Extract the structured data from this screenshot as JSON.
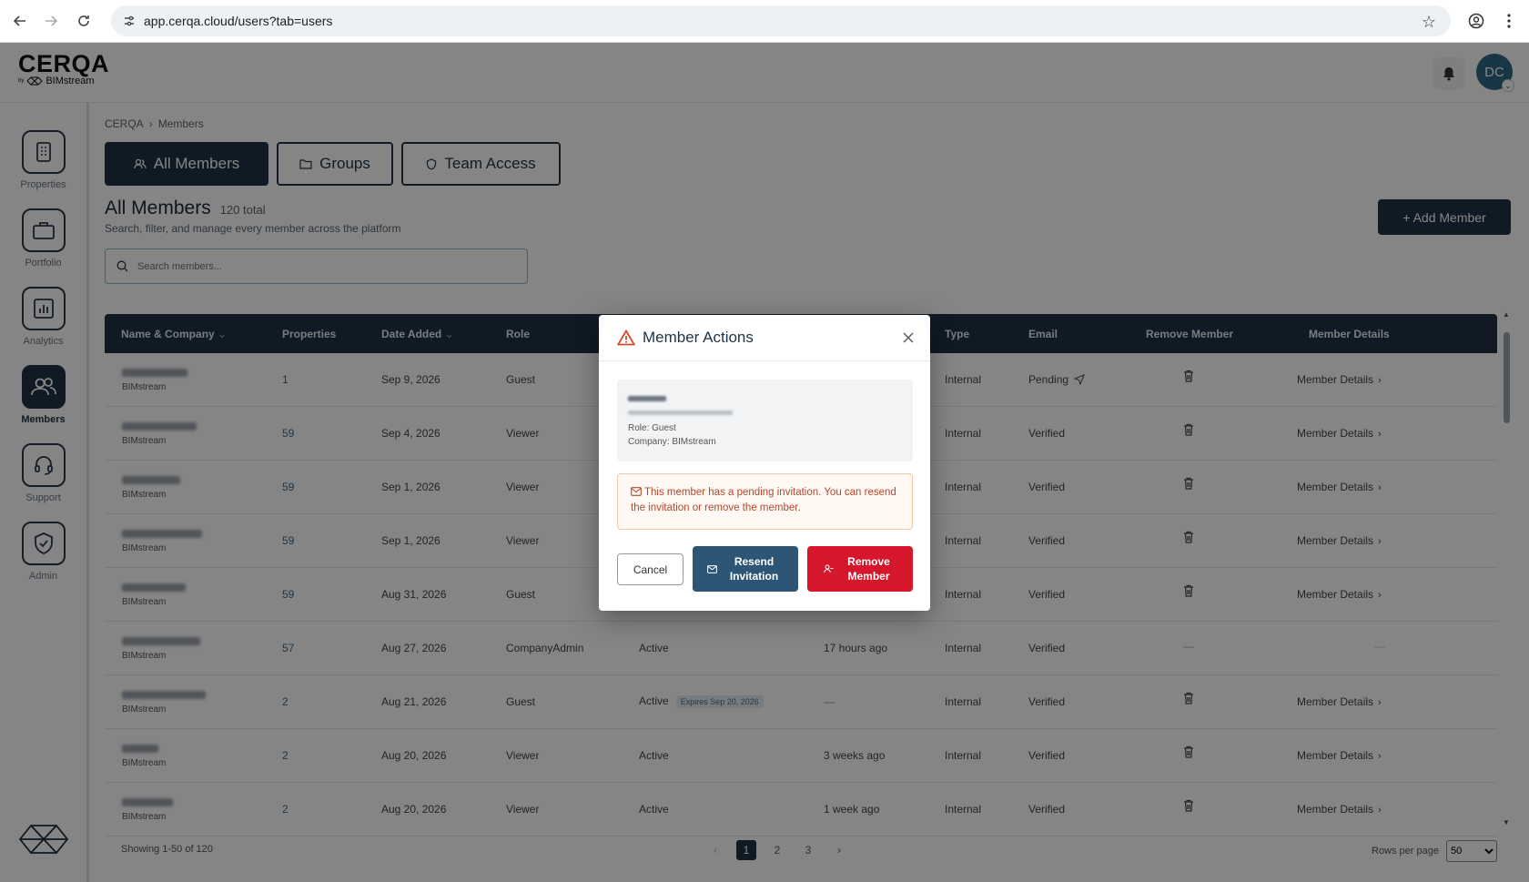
{
  "browser": {
    "url": "app.cerqa.cloud/users?tab=users"
  },
  "brand": {
    "name": "CERQA",
    "by": "by",
    "sub": "BIMstream"
  },
  "header": {
    "avatar_initials": "DC"
  },
  "sidebar": {
    "items": [
      {
        "label": "Properties",
        "icon": "building-icon"
      },
      {
        "label": "Portfolio",
        "icon": "briefcase-icon"
      },
      {
        "label": "Analytics",
        "icon": "chart-icon"
      },
      {
        "label": "Members",
        "icon": "users-icon",
        "active": true
      },
      {
        "label": "Support",
        "icon": "headset-icon"
      },
      {
        "label": "Admin",
        "icon": "shield-check-icon"
      }
    ]
  },
  "breadcrumb": [
    "CERQA",
    "›",
    "Members"
  ],
  "tabs": [
    {
      "label": "All Members",
      "active": true
    },
    {
      "label": "Groups"
    },
    {
      "label": "Team Access"
    }
  ],
  "page": {
    "title": "All Members",
    "count": "120 total",
    "subtitle": "Search, filter, and manage every member across the platform",
    "add_button": "+ Add Member",
    "search_placeholder": "Search members..."
  },
  "table": {
    "headers": [
      "Name & Company",
      "Properties",
      "Date Added",
      "Role",
      "Type",
      "Email",
      "Remove Member",
      "Member Details"
    ],
    "rows": [
      {
        "company": "BIMstream",
        "properties": "1",
        "date": "Sep 9, 2026",
        "role": "Guest",
        "status": "",
        "last": "",
        "type": "Internal",
        "email": "Pending",
        "details": "Member Details"
      },
      {
        "company": "BIMstream",
        "properties": "59",
        "date": "Sep 4, 2026",
        "role": "Viewer",
        "status": "",
        "last": "",
        "type": "Internal",
        "email": "Verified",
        "details": "Member Details"
      },
      {
        "company": "BIMstream",
        "properties": "59",
        "date": "Sep 1, 2026",
        "role": "Viewer",
        "status": "",
        "last": "",
        "type": "Internal",
        "email": "Verified",
        "details": "Member Details"
      },
      {
        "company": "BIMstream",
        "properties": "59",
        "date": "Sep 1, 2026",
        "role": "Viewer",
        "status": "",
        "last": "",
        "type": "Internal",
        "email": "Verified",
        "details": "Member Details"
      },
      {
        "company": "BIMstream",
        "properties": "59",
        "date": "Aug 31, 2026",
        "role": "Guest",
        "status": "",
        "last": "",
        "type": "Internal",
        "email": "Verified",
        "details": "Member Details"
      },
      {
        "company": "BIMstream",
        "properties": "57",
        "date": "Aug 27, 2026",
        "role": "CompanyAdmin",
        "status": "Active",
        "last": "17 hours ago",
        "type": "Internal",
        "email": "Verified",
        "details": ""
      },
      {
        "company": "BIMstream",
        "properties": "2",
        "date": "Aug 21, 2026",
        "role": "Guest",
        "status": "Active",
        "expires": "Expires Sep 20, 2026",
        "last": "—",
        "type": "Internal",
        "email": "Verified",
        "details": "Member Details"
      },
      {
        "company": "BIMstream",
        "properties": "2",
        "date": "Aug 20, 2026",
        "role": "Viewer",
        "status": "Active",
        "last": "3 weeks ago",
        "type": "Internal",
        "email": "Verified",
        "details": "Member Details"
      },
      {
        "company": "BIMstream",
        "properties": "2",
        "date": "Aug 20, 2026",
        "role": "Viewer",
        "status": "Active",
        "last": "1 week ago",
        "type": "Internal",
        "email": "Verified",
        "details": "Member Details"
      }
    ]
  },
  "footer": {
    "showing": "Showing 1-50 of 120",
    "pages": [
      "1",
      "2",
      "3"
    ],
    "rows_label": "Rows per page",
    "rows_value": "50"
  },
  "modal": {
    "title": "Member Actions",
    "role": "Role: Guest",
    "company": "Company: BIMstream",
    "warning": "This member has a pending invitation. You can resend the invitation or remove the member.",
    "cancel": "Cancel",
    "resend": "Resend Invitation",
    "remove": "Remove Member"
  }
}
